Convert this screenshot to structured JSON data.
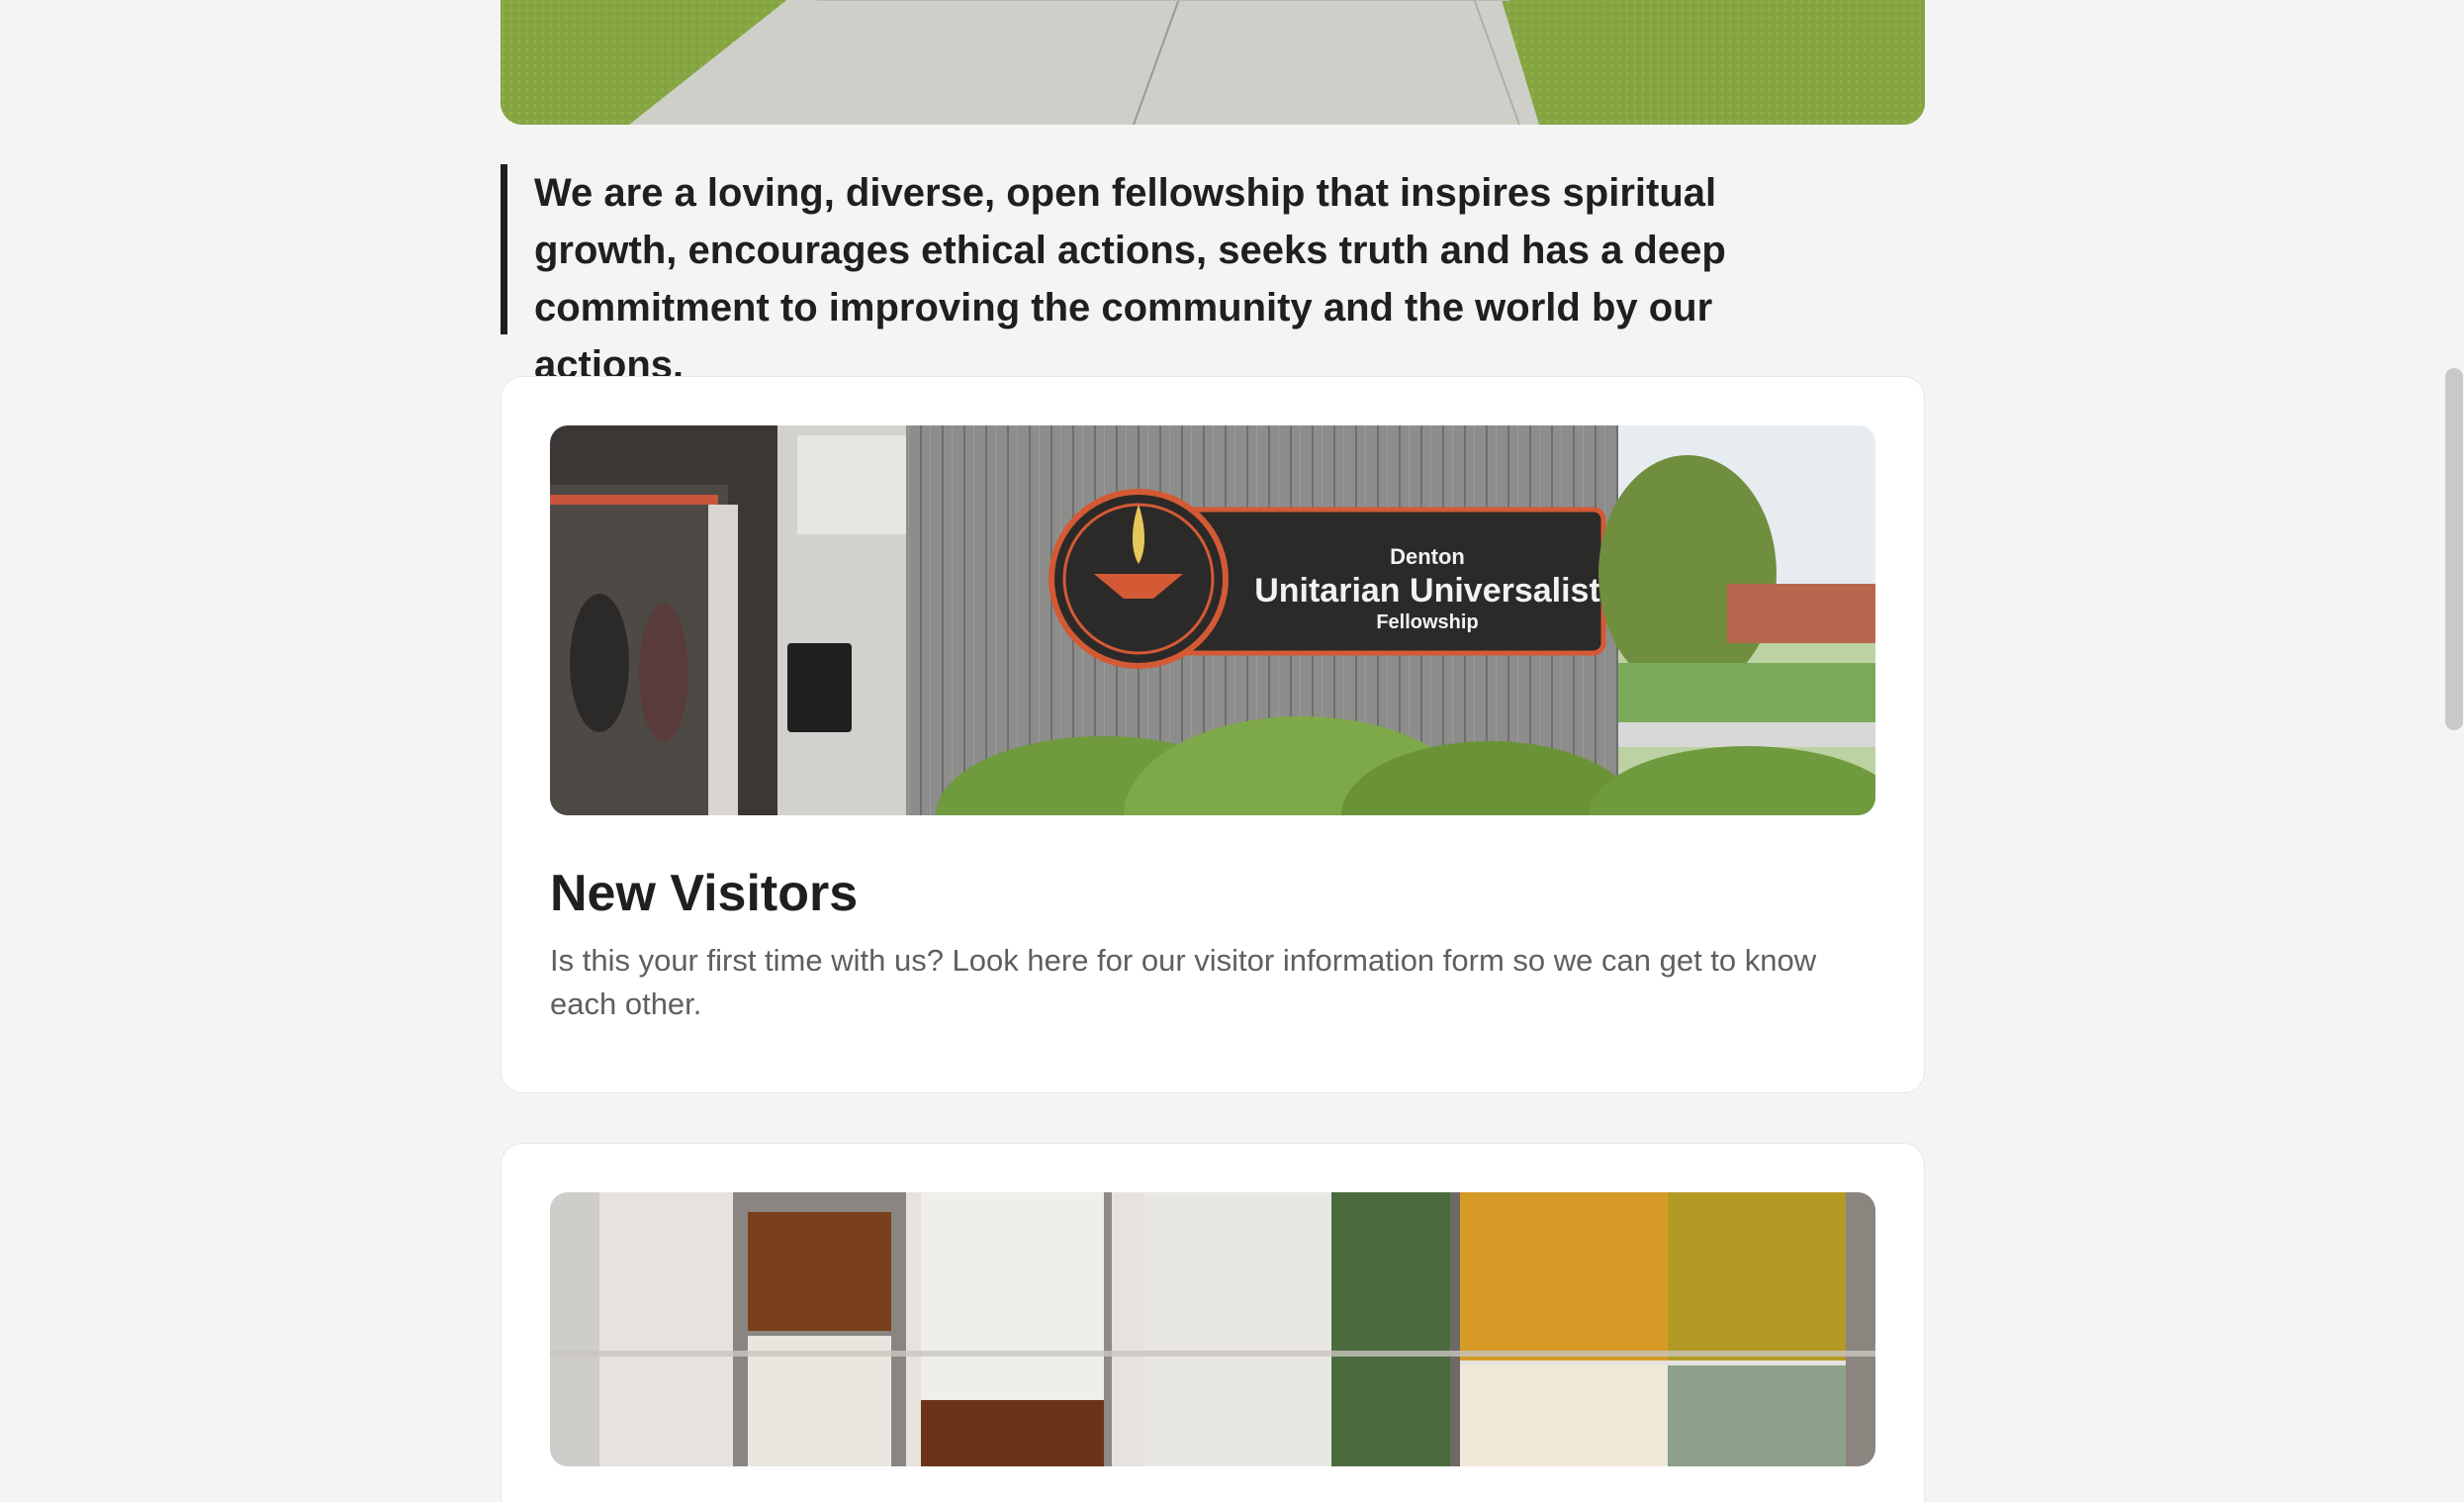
{
  "hero": {
    "image_alt": "Concrete walkway through green lawn"
  },
  "mission": {
    "text": "We are a loving, diverse, open fellowship that inspires spiritual growth, encourages ethical actions, seeks truth and has a deep commitment to improving the community and the world by our actions."
  },
  "cards": [
    {
      "image_alt": "Building entrance with sign",
      "sign": {
        "line1": "Denton",
        "line2": "Unitarian Universalist",
        "line3": "Fellowship"
      },
      "title": "New Visitors",
      "text": "Is this your first time with us? Look here for our visitor information form so we can get to know each other."
    },
    {
      "image_alt": "Stained glass window panels"
    }
  ],
  "colors": {
    "page_background": "#f4f4f4",
    "card_background": "#ffffff",
    "heading_text": "#1f1f1f",
    "body_text": "#5f5f5f",
    "sign_accent": "#d45a35"
  }
}
